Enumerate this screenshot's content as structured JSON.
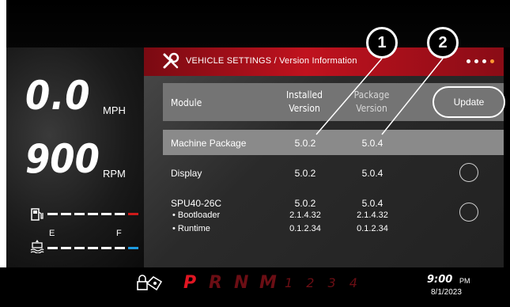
{
  "colors": {
    "accent_red": "#c0121e",
    "header_gray": "#747474",
    "highlight_gray": "#8a8a8a",
    "fuel_low": "#cc1a1a",
    "water_level": "#1e9be0"
  },
  "gauges": {
    "speed_value": "0.0",
    "speed_unit": "MPH",
    "rpm_value": "900",
    "rpm_unit": "RPM",
    "fuel_icon": "fuel-pump-icon",
    "water_icon": "water-tank-icon",
    "empty_label": "E",
    "full_label": "F"
  },
  "titlebar": {
    "icon": "wrench-screwdriver-icon",
    "title": "VEHICLE SETTINGS / Version Information",
    "page_count": 4,
    "active_page": 4
  },
  "table": {
    "headers": {
      "module": "Module",
      "installed_1": "Installed",
      "installed_2": "Version",
      "package_1": "Package",
      "package_2": "Version"
    },
    "update_label": "Update",
    "rows": [
      {
        "module": "Machine Package",
        "installed": "5.0.2",
        "package": "5.0.4"
      },
      {
        "module": "Display",
        "installed": "5.0.2",
        "package": "5.0.4"
      },
      {
        "module": "SPU40-26C",
        "installed": "5.0.2",
        "package": "5.0.4"
      }
    ],
    "subrows": [
      {
        "module": "• Bootloader",
        "installed": "2.1.4.32",
        "package": "2.1.4.32"
      },
      {
        "module": "• Runtime",
        "installed": "0.1.2.34",
        "package": "0.1.2.34"
      }
    ]
  },
  "status": {
    "lock_icon": "transmission-lock-icon",
    "gears": [
      "P",
      "R",
      "N",
      "M"
    ],
    "active_gear": "P",
    "numbers": "1 2 3 4",
    "time": "9:00",
    "ampm": "PM",
    "date": "8/1/2023"
  },
  "callouts": [
    "1",
    "2"
  ]
}
